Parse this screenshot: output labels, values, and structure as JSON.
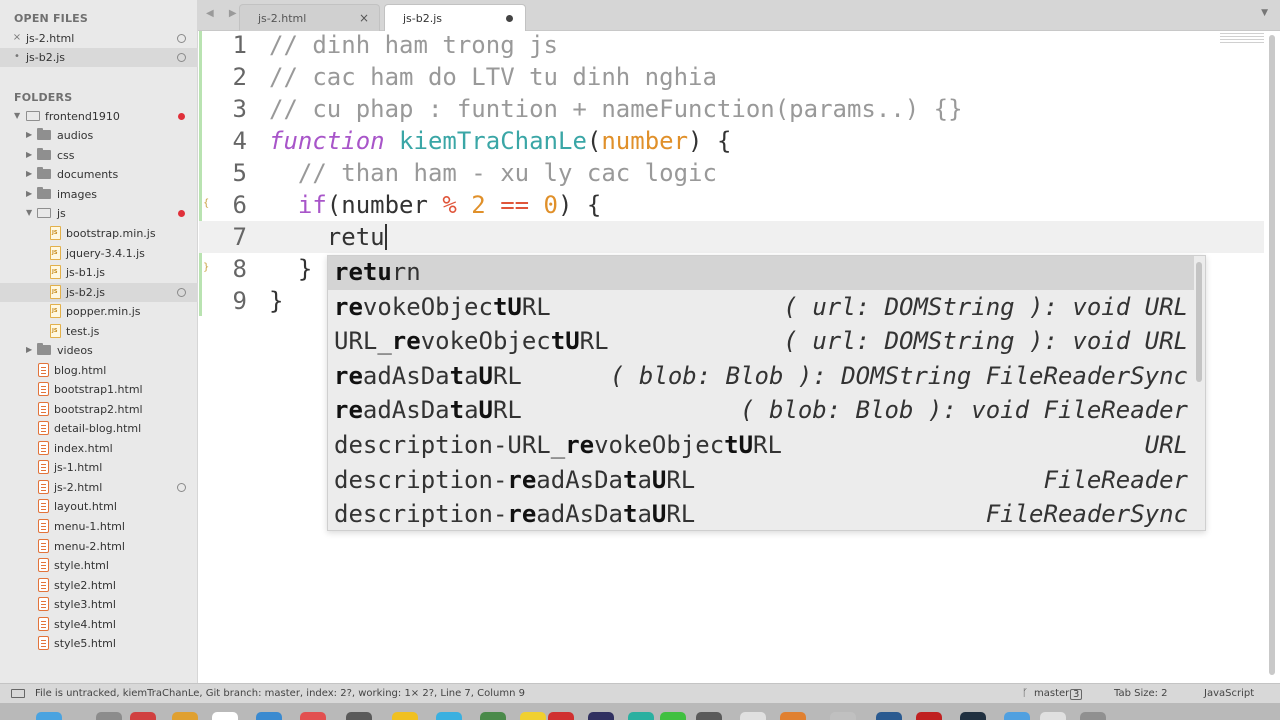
{
  "sidebar": {
    "open_files_header": "OPEN FILES",
    "open_files": [
      {
        "label": "js-2.html",
        "close": "×"
      },
      {
        "label": "js-b2.js",
        "close": "•"
      }
    ],
    "folders_header": "FOLDERS",
    "root": "frontend1910",
    "tree": [
      {
        "label": "audios"
      },
      {
        "label": "css"
      },
      {
        "label": "documents"
      },
      {
        "label": "images"
      },
      {
        "label": "js"
      },
      {
        "label": "bootstrap.min.js"
      },
      {
        "label": "jquery-3.4.1.js"
      },
      {
        "label": "js-b1.js"
      },
      {
        "label": "js-b2.js"
      },
      {
        "label": "popper.min.js"
      },
      {
        "label": "test.js"
      },
      {
        "label": "videos"
      },
      {
        "label": "blog.html"
      },
      {
        "label": "bootstrap1.html"
      },
      {
        "label": "bootstrap2.html"
      },
      {
        "label": "detail-blog.html"
      },
      {
        "label": "index.html"
      },
      {
        "label": "js-1.html"
      },
      {
        "label": "js-2.html"
      },
      {
        "label": "layout.html"
      },
      {
        "label": "menu-1.html"
      },
      {
        "label": "menu-2.html"
      },
      {
        "label": "style.html"
      },
      {
        "label": "style2.html"
      },
      {
        "label": "style3.html"
      },
      {
        "label": "style4.html"
      },
      {
        "label": "style5.html"
      }
    ]
  },
  "tabs": [
    {
      "label": "js-2.html",
      "close": "×"
    },
    {
      "label": "js-b2.js"
    }
  ],
  "tab_nav": "◀ ▶",
  "tab_menu": "▼",
  "editor": {
    "line_numbers": [
      "1",
      "2",
      "3",
      "4",
      "5",
      "6",
      "7",
      "8",
      "9"
    ],
    "l1": "// dinh ham trong js",
    "l2": "// cac ham do LTV tu dinh nghia",
    "l3": "// cu phap : funtion + nameFunction(params..) {}",
    "l4": {
      "kw": "function",
      "name": "kiemTraChanLe",
      "open": "(",
      "param": "number",
      "close": ") {"
    },
    "l5": "  // than ham - xu ly cac logic",
    "l6": {
      "kw": "  if",
      "open": "(number ",
      "op1": "%",
      "n1": " 2 ",
      "op2": "==",
      "n2": " 0",
      "close": ") {"
    },
    "l7": "    retu",
    "l8": "  }",
    "l9": "}"
  },
  "autocomplete": [
    {
      "parts": [
        [
          "b",
          "retu"
        ],
        [
          "",
          "rn"
        ]
      ],
      "hint": ""
    },
    {
      "parts": [
        [
          "b",
          "re"
        ],
        [
          "",
          "vokeObjec"
        ],
        [
          "b",
          "tU"
        ],
        [
          "",
          "RL"
        ]
      ],
      "hint": "( url: DOMString ): void URL"
    },
    {
      "parts": [
        [
          "",
          "URL_"
        ],
        [
          "b",
          "re"
        ],
        [
          "",
          "vokeObjec"
        ],
        [
          "b",
          "tU"
        ],
        [
          "",
          "RL"
        ]
      ],
      "hint": "( url: DOMString ): void URL"
    },
    {
      "parts": [
        [
          "b",
          "re"
        ],
        [
          "",
          "adAsDa"
        ],
        [
          "b",
          "t"
        ],
        [
          "",
          "a"
        ],
        [
          "b",
          "U"
        ],
        [
          "",
          "RL"
        ]
      ],
      "hint": "( blob: Blob ): DOMString FileReaderSync"
    },
    {
      "parts": [
        [
          "b",
          "re"
        ],
        [
          "",
          "adAsDa"
        ],
        [
          "b",
          "t"
        ],
        [
          "",
          "a"
        ],
        [
          "b",
          "U"
        ],
        [
          "",
          "RL"
        ]
      ],
      "hint": "( blob: Blob ): void FileReader"
    },
    {
      "parts": [
        [
          "",
          "description-URL_"
        ],
        [
          "b",
          "re"
        ],
        [
          "",
          "vokeObjec"
        ],
        [
          "b",
          "tU"
        ],
        [
          "",
          "RL"
        ]
      ],
      "hint": "URL"
    },
    {
      "parts": [
        [
          "",
          "description-"
        ],
        [
          "b",
          "re"
        ],
        [
          "",
          "adAsDa"
        ],
        [
          "b",
          "t"
        ],
        [
          "",
          "a"
        ],
        [
          "b",
          "U"
        ],
        [
          "",
          "RL"
        ]
      ],
      "hint": "FileReader"
    },
    {
      "parts": [
        [
          "",
          "description-"
        ],
        [
          "b",
          "re"
        ],
        [
          "",
          "adAsDa"
        ],
        [
          "b",
          "t"
        ],
        [
          "",
          "a"
        ],
        [
          "b",
          "U"
        ],
        [
          "",
          "RL"
        ]
      ],
      "hint": "FileReaderSync"
    }
  ],
  "statusbar": {
    "message": "File is untracked, kiemTraChanLe, Git branch: master, index: 2?, working: 1× 2?, Line 7, Column 9",
    "branch": "master",
    "branch_count": "3",
    "tab_size": "Tab Size: 2",
    "syntax": "JavaScript"
  }
}
